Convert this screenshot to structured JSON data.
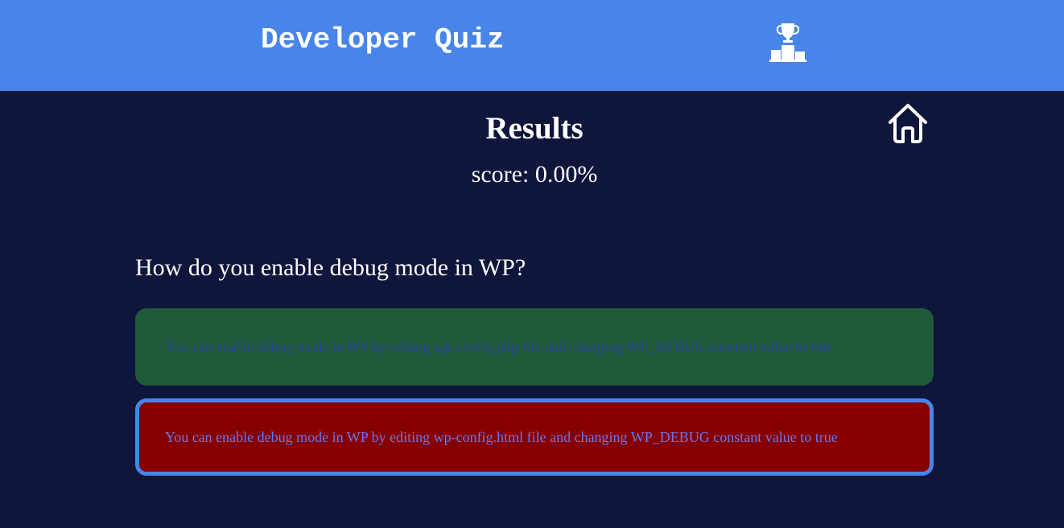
{
  "header": {
    "title": "Developer Quiz",
    "background_color": "#4885e9",
    "leaderboard_icon": "podium-trophy-icon"
  },
  "nav": {
    "home_icon": "home-icon"
  },
  "results": {
    "heading": "Results",
    "score_text": "score: 0.00%",
    "score_value_percent": 0.0
  },
  "question": {
    "text": "How do you enable debug mode in WP?",
    "answers": [
      {
        "text": "You can enable debug mode in WP by editing wp-config.php file and changing WP_DEBUG constant value to true",
        "status": "correct",
        "background_color": "#1e5a3a",
        "text_color": "#2a3f9a"
      },
      {
        "text": "You can enable debug mode in WP by editing wp-config.html file and changing WP_DEBUG constant value to true",
        "status": "selected-incorrect",
        "background_color": "#870000",
        "text_color": "#6a78f2",
        "border_color": "#4885e9"
      }
    ]
  },
  "page": {
    "background_color": "#0f153b"
  }
}
